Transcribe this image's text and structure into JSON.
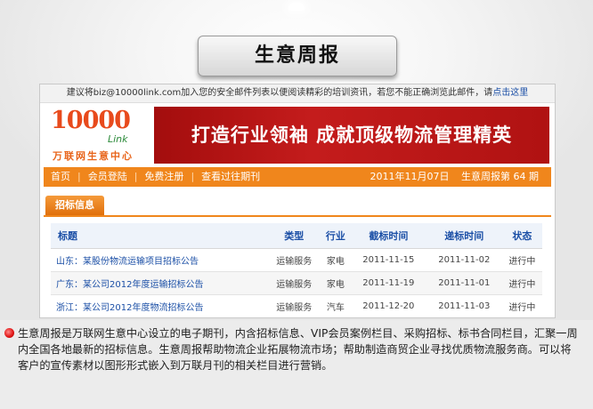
{
  "page": {
    "title": "生意周报"
  },
  "notice": {
    "text": "建议将biz@10000link.com加入您的安全邮件列表以便阅读精彩的培训资讯，若您不能正确浏览此邮件，请",
    "link": "点击这里"
  },
  "logo": {
    "brand": "10000",
    "brand_sub": "Link",
    "site_name": "万联网生意中心"
  },
  "banner": {
    "text": "打造行业领袖 成就顶级物流管理精英"
  },
  "nav": {
    "items": [
      "首页",
      "会员登陆",
      "免费注册",
      "查看过往期刊"
    ],
    "date": "2011年11月07日",
    "issue": "生意周报第 64 期"
  },
  "section": {
    "tab": "招标信息"
  },
  "table": {
    "headers": [
      "标题",
      "类型",
      "行业",
      "截标时间",
      "递标时间",
      "状态"
    ],
    "rows": [
      [
        "山东：某股份物流运输项目招标公告",
        "运输服务",
        "家电",
        "2011-11-15",
        "2011-11-02",
        "进行中"
      ],
      [
        "广东：某公司2012年度运输招标公告",
        "运输服务",
        "家电",
        "2011-11-19",
        "2011-11-01",
        "进行中"
      ],
      [
        "浙江：某公司2012年度物流招标公告",
        "运输服务",
        "汽车",
        "2011-12-20",
        "2011-11-03",
        "进行中"
      ]
    ]
  },
  "description": "生意周报是万联网生意中心设立的电子期刊，内含招标信息、VIP会员案例栏目、采购招标、标书合同栏目，汇聚一周内全国各地最新的招标信息。生意周报帮助物流企业拓展物流市场；帮助制造商贸企业寻找优质物流服务商。可以将客户的宣传素材以图形形式嵌入到万联月刊的相关栏目进行营销。",
  "colors": {
    "accent": "#f0861c",
    "banner": "#b01212",
    "link": "#1b4fa6",
    "bullet": "#e21a1a"
  }
}
